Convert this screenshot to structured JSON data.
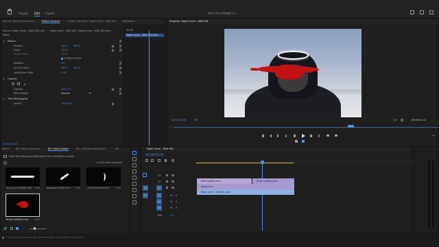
{
  "topbar": {
    "tabs": [
      "Import",
      "Edit",
      "Export"
    ],
    "active_tab": "Edit",
    "project_title": "Paint fall effect",
    "project_status": "Edited"
  },
  "effect_controls": {
    "tabs": [
      "Source: Blood Lineal.mov",
      "Effect Controls",
      "Audio Clip Mixer: Night Level - BAD KID",
      "Metadata"
    ],
    "source_line": "Source: Night Level - BAD KID.mov",
    "sequence_line": "Night Level - BAD KID * Night Level - BAD KID.mov",
    "section_video": "Video",
    "rows": [
      {
        "label": "Motion",
        "value": ""
      },
      {
        "label": "Position",
        "value": "640.0",
        "value2": "360.0"
      },
      {
        "label": "Scale",
        "value": "100.0"
      },
      {
        "label": "Scale Width",
        "value": "100.0"
      },
      {
        "label": "Uniform Scale",
        "value": ""
      },
      {
        "label": "Rotation",
        "value": "0.0"
      },
      {
        "label": "Anchor Point",
        "value": "640.0",
        "value2": "360.0"
      },
      {
        "label": "Anti-flicker Filter",
        "value": "0.00"
      },
      {
        "label": "Opacity",
        "value": ""
      },
      {
        "label": "Opacity",
        "value": "100.0 %"
      },
      {
        "label": "Blend Mode",
        "value": "Normal"
      },
      {
        "label": "Time Remapping",
        "value": ""
      },
      {
        "label": "Speed",
        "value": "100.00%"
      }
    ],
    "mini_timeline_time": "00:00",
    "mini_clip_label": "Night Level - BAD KID.mov",
    "timecode": "00:00:01:00"
  },
  "program": {
    "tab": "Program: Night Level - BAD KID",
    "timecode": "00:00:01:00",
    "fit": "Fit",
    "quality": "1/4",
    "duration": "00:00:01:12"
  },
  "effects_panel": {
    "tabs": [
      "Effect",
      "Bin: Paper Textures",
      "Bin: Paint Assets",
      "Bin: Ultimate Paint Pack",
      "Me"
    ],
    "path": "Paint fall effect.prproj\\Ultimate Paint Pack\\Paint Assets",
    "count": "1 of 38 items selected",
    "items": [
      {
        "name": "long paint stroke.mov",
        "duration": "1:10"
      },
      {
        "name": "diagonal stroke.mov",
        "duration": "1:15"
      },
      {
        "name": "curved stroke.mov",
        "duration": "1:10"
      },
      {
        "name": "Blood splatter.mov",
        "duration": "1:12"
      }
    ]
  },
  "timeline": {
    "tab": "Night Level - BAD KID",
    "timecode": "00:00:01:00",
    "tracks": [
      {
        "name": "V3",
        "clip": "Blood splatter.mov"
      },
      {
        "name": "V2",
        "clip": "Yellow.mov"
      },
      {
        "name": "V1",
        "clip": "Night Level - BAD KID.mp4"
      },
      {
        "name": "A1",
        "clip": ""
      },
      {
        "name": "A2",
        "clip": ""
      },
      {
        "name": "A3",
        "clip": ""
      },
      {
        "name": "Mix",
        "clip": "0.0"
      }
    ],
    "adj_clip": "Paint splatter.mov"
  },
  "status": {
    "text": "Click to split clip here. Alt extends a link. Cmd: Shift to all tracks."
  },
  "colors": {
    "accent": "#4b8df8",
    "paint": "#c21213",
    "clip_v1": "#8fb0e0",
    "clip_v2": "#a798cf"
  }
}
